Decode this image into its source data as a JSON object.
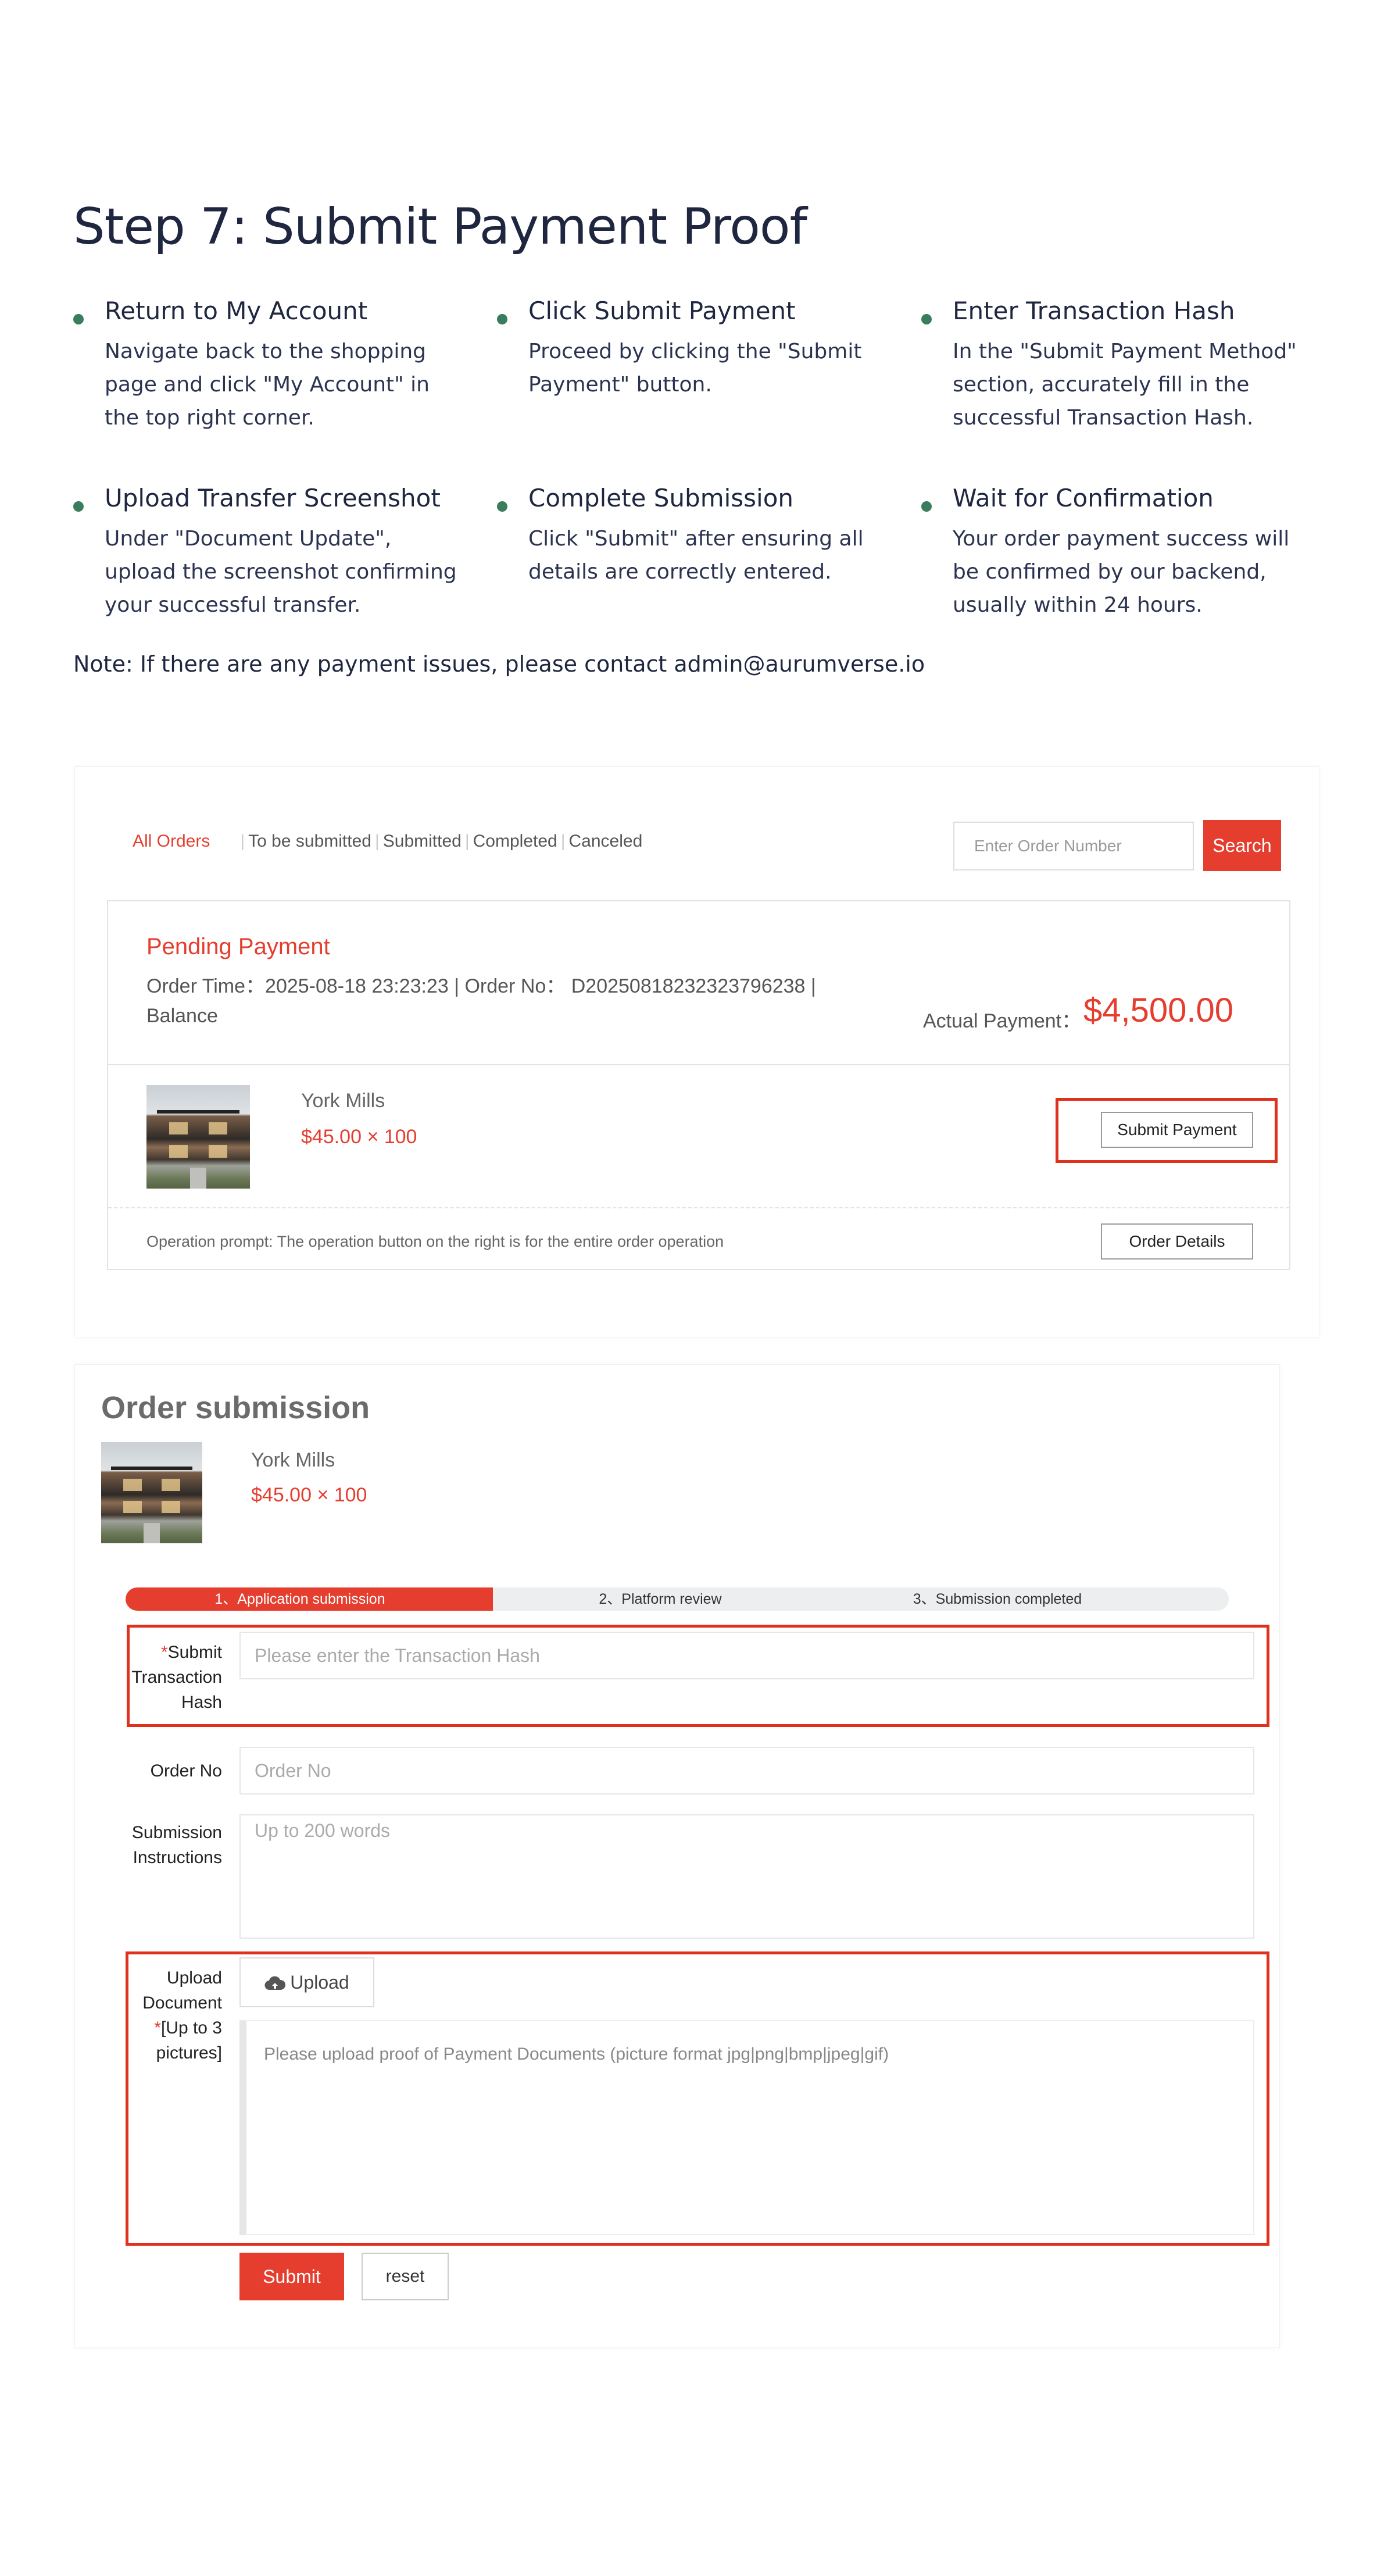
{
  "guide": {
    "title": "Step 7: Submit Payment Proof",
    "items": [
      {
        "heading": "Return to My Account",
        "text": "Navigate back to the shopping page and click \"My Account\" in the top right corner."
      },
      {
        "heading": "Click Submit Payment",
        "text": "Proceed by clicking the \"Submit Payment\" button."
      },
      {
        "heading": "Enter Transaction Hash",
        "text": "In the \"Submit Payment Method\" section, accurately fill in the successful Transaction Hash."
      },
      {
        "heading": "Upload Transfer Screenshot",
        "text": "Under \"Document Update\", upload the screenshot confirming your successful transfer."
      },
      {
        "heading": "Complete Submission",
        "text": "Click \"Submit\" after ensuring all details are correctly entered."
      },
      {
        "heading": "Wait for Confirmation",
        "text": "Your order payment success will be confirmed by our backend, usually within 24 hours."
      }
    ],
    "note": "Note: If there are any payment issues, please contact admin@aurumverse.io"
  },
  "orders": {
    "tabs": [
      "All Orders",
      "To be submitted",
      "Submitted",
      "Completed",
      "Canceled"
    ],
    "search_placeholder": "Enter Order Number",
    "search_button": "Search",
    "status": "Pending Payment",
    "meta": "Order Time：2025-08-18 23:23:23 | Order No： D20250818232323796238 |",
    "method": "Balance",
    "actual_label": "Actual Payment：",
    "actual_value": "$4,500.00",
    "product_name": "York Mills",
    "product_price": "$45.00 × 100",
    "submit_payment_button": "Submit Payment",
    "operation_prompt": "Operation prompt: The operation button on the right is for the entire order operation",
    "order_details_button": "Order Details"
  },
  "submission": {
    "title": "Order submission",
    "product_name": "York Mills",
    "product_price": "$45.00 × 100",
    "steps": [
      "1、Application submission",
      "2、Platform review",
      "3、Submission completed"
    ],
    "progress_fraction": 0.333,
    "hash_required_mark": "*",
    "hash_label": "Submit Transaction Hash",
    "hash_placeholder": "Please enter the Transaction Hash",
    "order_no_label": "Order No",
    "order_no_placeholder": "Order No",
    "instructions_label": "Submission Instructions",
    "instructions_placeholder": "Up to 200 words",
    "upload_label": "Upload Document",
    "upload_required_mark": "*",
    "upload_limit": "[Up to 3 pictures]",
    "upload_button": "Upload",
    "upload_hint": "Please upload proof of Payment Documents (picture format jpg|png|bmp|jpeg|gif)",
    "submit_button": "Submit",
    "reset_button": "reset"
  },
  "colors": {
    "accent": "#e53e2f",
    "bullet": "#3a7d5c",
    "highlight": "#e0301e"
  }
}
